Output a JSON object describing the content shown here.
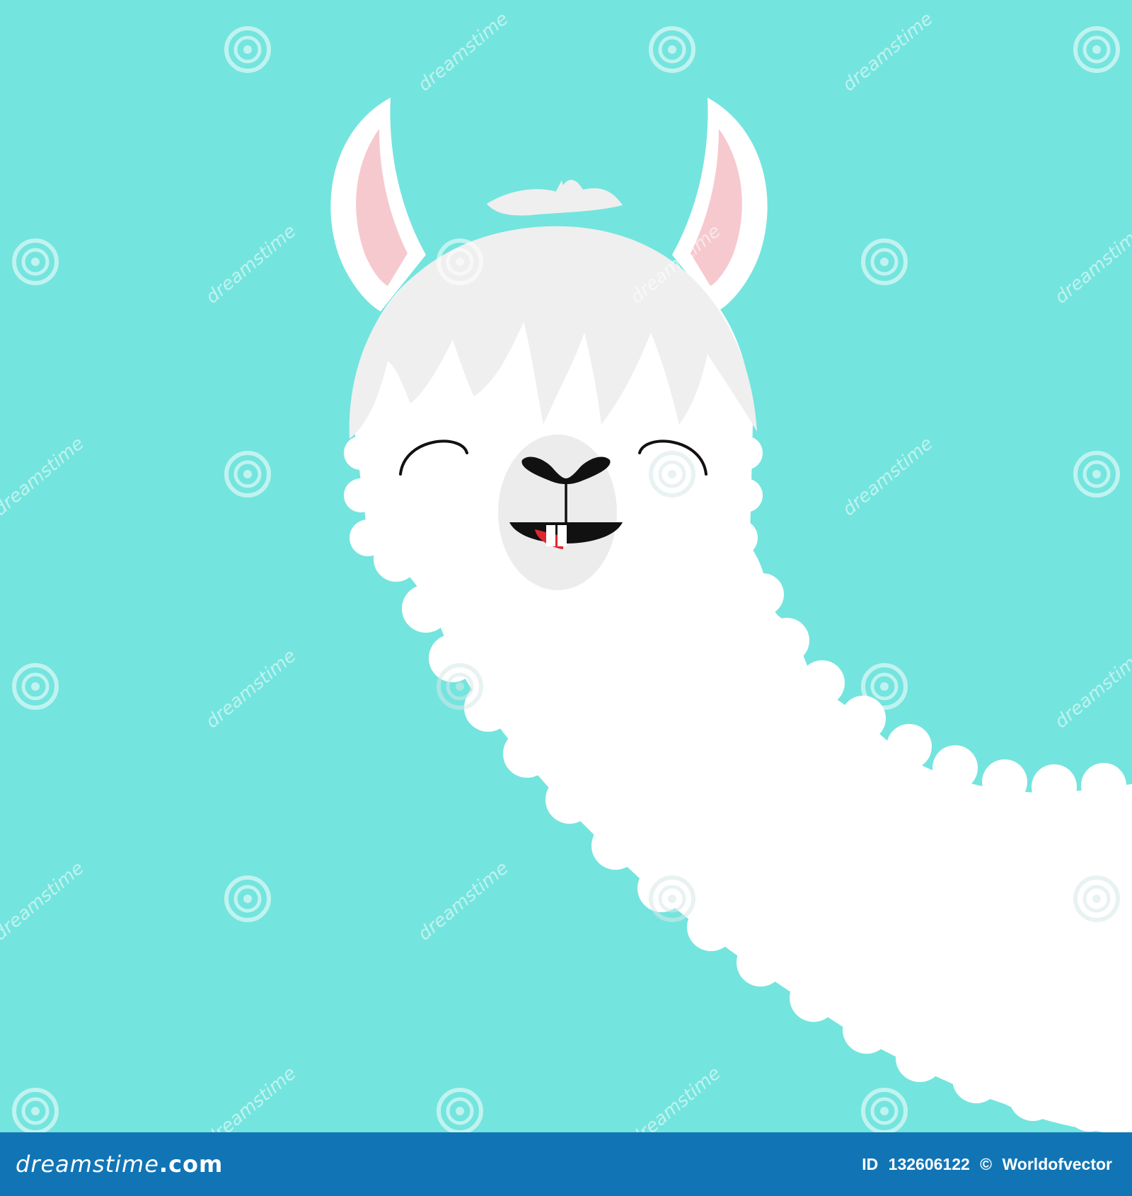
{
  "colors": {
    "background": "#74e4de",
    "fur": "#ffffff",
    "hair": "#efefef",
    "inner_ear": "#f6c9cf",
    "muzzle": "#ececec",
    "face_lines": "#111111",
    "mouth_accent": "#e0262d",
    "footer": "#1175b5",
    "watermark": "#ffffff"
  },
  "icons": {
    "watermark": "spiral-icon"
  },
  "footer": {
    "brand_main": "dreamstime",
    "brand_suffix": ".com",
    "id_label": "ID",
    "id_value": "132606122",
    "copyright_symbol": "©",
    "author": "Worldofvector"
  },
  "watermark": {
    "text": "dreamstime"
  }
}
